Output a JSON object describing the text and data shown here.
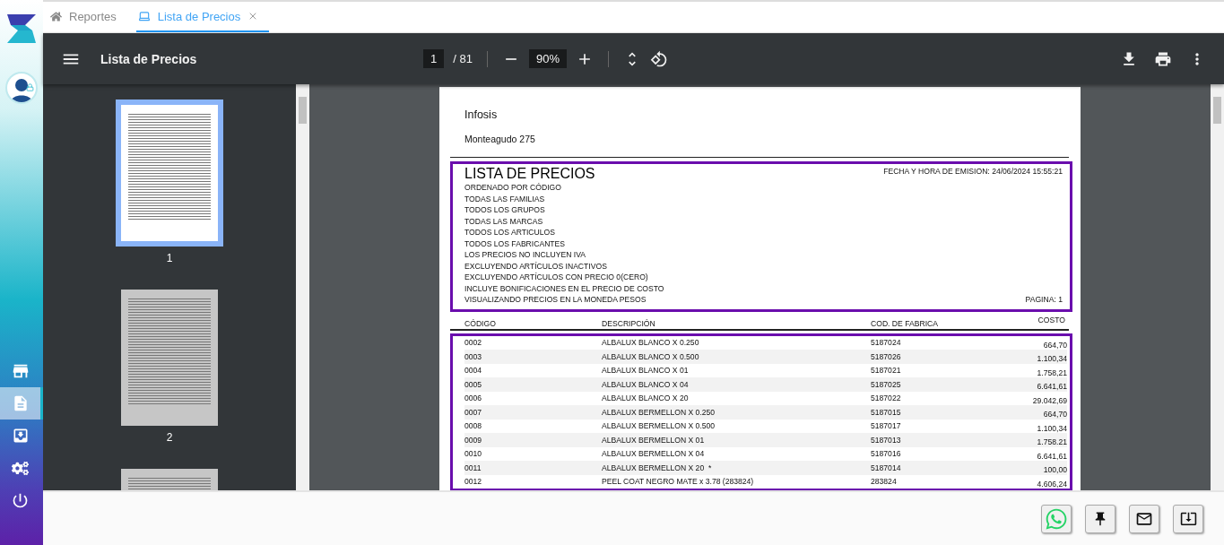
{
  "tabs": [
    {
      "label": "Reportes",
      "kind": "home",
      "selected": false,
      "closable": false
    },
    {
      "label": "Lista de Precios",
      "kind": "laptop",
      "selected": true,
      "closable": true
    }
  ],
  "sidebar": {
    "items": [
      {
        "kind": "store",
        "selected": false
      },
      {
        "kind": "document",
        "selected": true
      },
      {
        "kind": "inbox",
        "selected": false
      },
      {
        "kind": "gears",
        "selected": false
      },
      {
        "kind": "power",
        "selected": false
      }
    ]
  },
  "viewer": {
    "title": "Lista de Precios",
    "page": "1",
    "page_total": "/ 81",
    "zoom": "90%",
    "thumbnails": [
      {
        "label": "1",
        "selected": true
      },
      {
        "label": "2",
        "selected": false
      },
      {
        "selected": false
      }
    ]
  },
  "document": {
    "company": "Infosis",
    "address": "Monteagudo 275",
    "title": "LISTA DE PRECIOS",
    "emission": "FECHA Y HORA DE EMISION: 24/06/2024 15:55:21",
    "filters": [
      "ORDENADO POR CÓDIGO",
      "TODAS LAS FAMILIAS",
      "TODOS LOS GRUPOS",
      "TODAS LAS MARCAS",
      "TODOS LOS ARTICULOS",
      "TODOS LOS FABRICANTES",
      "LOS PRECIOS NO INCLUYEN IVA",
      "EXCLUYENDO ARTÍCULOS INACTIVOS",
      "EXCLUYENDO ARTÍCULOS CON PRECIO 0(CERO)",
      "INCLUYE BONIFICACIONES EN EL PRECIO DE COSTO",
      "VISUALIZANDO PRECIOS EN LA MONEDA PESOS"
    ],
    "page_label": "PAGINA: 1",
    "columns": [
      "CÓDIGO",
      "DESCRIPCIÓN",
      "COD. DE FABRICA",
      "COSTO"
    ],
    "rows": [
      [
        "0002",
        "ALBALUX BLANCO X 0.250",
        "5187024",
        "664,70"
      ],
      [
        "0003",
        "ALBALUX BLANCO X 0.500",
        "5187026",
        "1.100,34"
      ],
      [
        "0004",
        "ALBALUX BLANCO X 01",
        "5187021",
        "1.758,21"
      ],
      [
        "0005",
        "ALBALUX BLANCO X 04",
        "5187025",
        "6.641,61"
      ],
      [
        "0006",
        "ALBALUX BLANCO X 20",
        "5187022",
        "29.042,69"
      ],
      [
        "0007",
        "ALBALUX BERMELLON X 0.250",
        "5187015",
        "664,70"
      ],
      [
        "0008",
        "ALBALUX BERMELLON X 0.500",
        "5187017",
        "1.100,34"
      ],
      [
        "0009",
        "ALBALUX BERMELLON X 01",
        "5187013",
        "1.758.21"
      ],
      [
        "0010",
        "ALBALUX BERMELLON X 04",
        "5187016",
        "6.641,61"
      ],
      [
        "0011",
        "ALBALUX BERMELLON X 20  *",
        "5187014",
        "100,00"
      ],
      [
        "0012",
        "PEEL COAT NEGRO MATE x 3.78 (283824)",
        "283824",
        "4.606,24"
      ]
    ]
  },
  "actions": [
    {
      "kind": "whatsapp"
    },
    {
      "kind": "pin"
    },
    {
      "kind": "mail"
    },
    {
      "kind": "download"
    }
  ]
}
